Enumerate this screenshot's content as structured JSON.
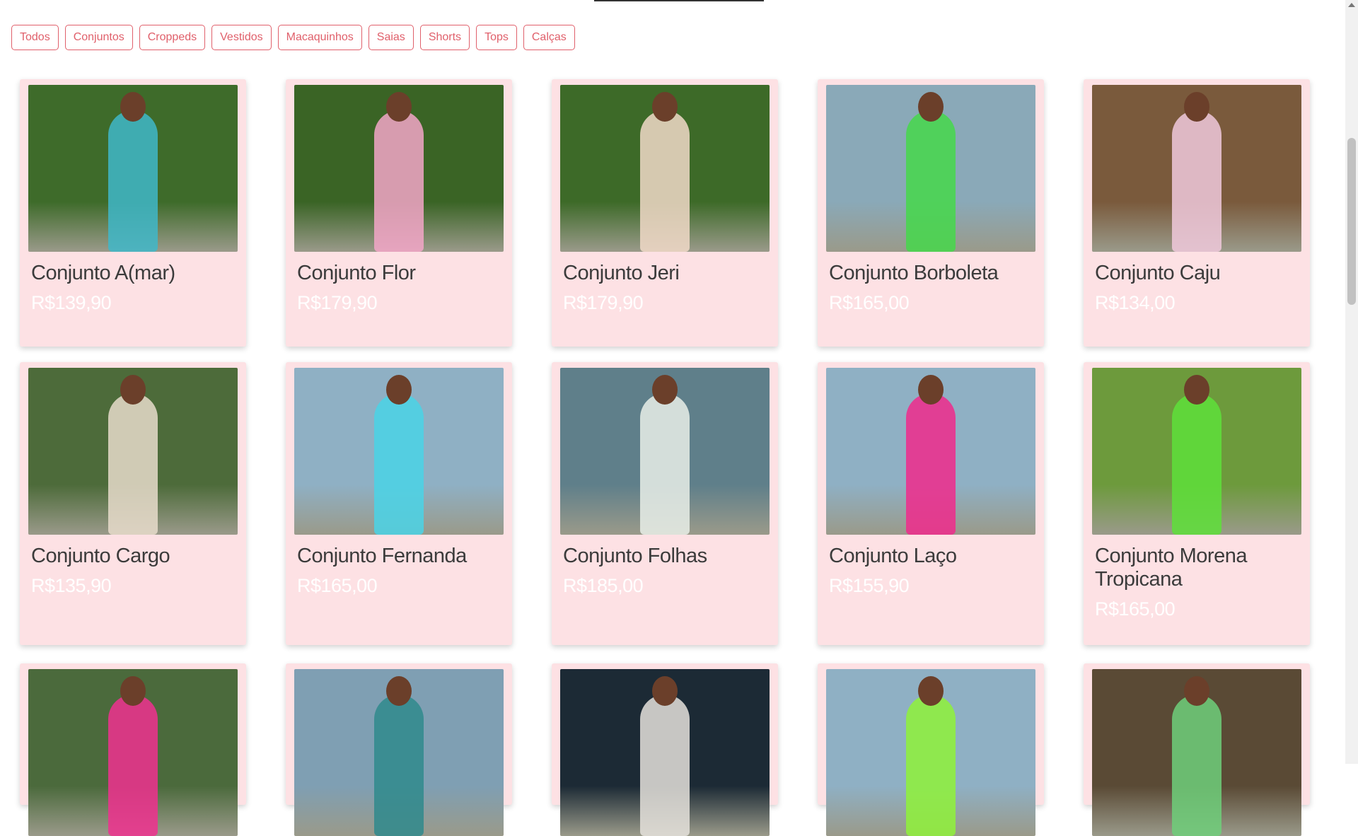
{
  "filters": [
    "Todos",
    "Conjuntos",
    "Croppeds",
    "Vestidos",
    "Macaquinhos",
    "Saias",
    "Shorts",
    "Tops",
    "Calças"
  ],
  "products_row1": [
    {
      "name": "Conjunto A(mar)",
      "price": "R$139,90",
      "bg": "#3e6b2a",
      "outfit": "#3fb7c9"
    },
    {
      "name": "Conjunto Flor",
      "price": "R$179,90",
      "bg": "#3a6425",
      "outfit": "#f3a6c8"
    },
    {
      "name": "Conjunto Jeri",
      "price": "R$179,90",
      "bg": "#3d6a28",
      "outfit": "#f1d9c8"
    },
    {
      "name": "Conjunto Borboleta",
      "price": "R$165,00",
      "bg": "#8aa9b8",
      "outfit": "#45d84a"
    },
    {
      "name": "Conjunto Caju",
      "price": "R$134,00",
      "bg": "#7a5a3c",
      "outfit": "#f0c9dc"
    }
  ],
  "products_row2": [
    {
      "name": "Conjunto Cargo",
      "price": "R$135,90",
      "bg": "#4d6b3a",
      "outfit": "#e8dccb"
    },
    {
      "name": "Conjunto Fernanda",
      "price": "R$165,00",
      "bg": "#8fb0c4",
      "outfit": "#4ad3e6"
    },
    {
      "name": "Conjunto Folhas",
      "price": "R$185,00",
      "bg": "#5f7f8a",
      "outfit": "#e9efe8"
    },
    {
      "name": "Conjunto Laço",
      "price": "R$155,90",
      "bg": "#8fb0c4",
      "outfit": "#f02a8c"
    },
    {
      "name": "Conjunto Morena Tropicana",
      "price": "R$165,00",
      "bg": "#6d9a3c",
      "outfit": "#5ee03a"
    }
  ],
  "products_row3": [
    {
      "bg": "#4b6a3c",
      "outfit": "#f0308f"
    },
    {
      "bg": "#7f9fb3",
      "outfit": "#2f8a8c"
    },
    {
      "bg": "#1c2a35",
      "outfit": "#e5e2dc"
    },
    {
      "bg": "#8fb0c4",
      "outfit": "#8ff23a"
    },
    {
      "bg": "#5a4a35",
      "outfit": "#6fcf7a"
    }
  ]
}
